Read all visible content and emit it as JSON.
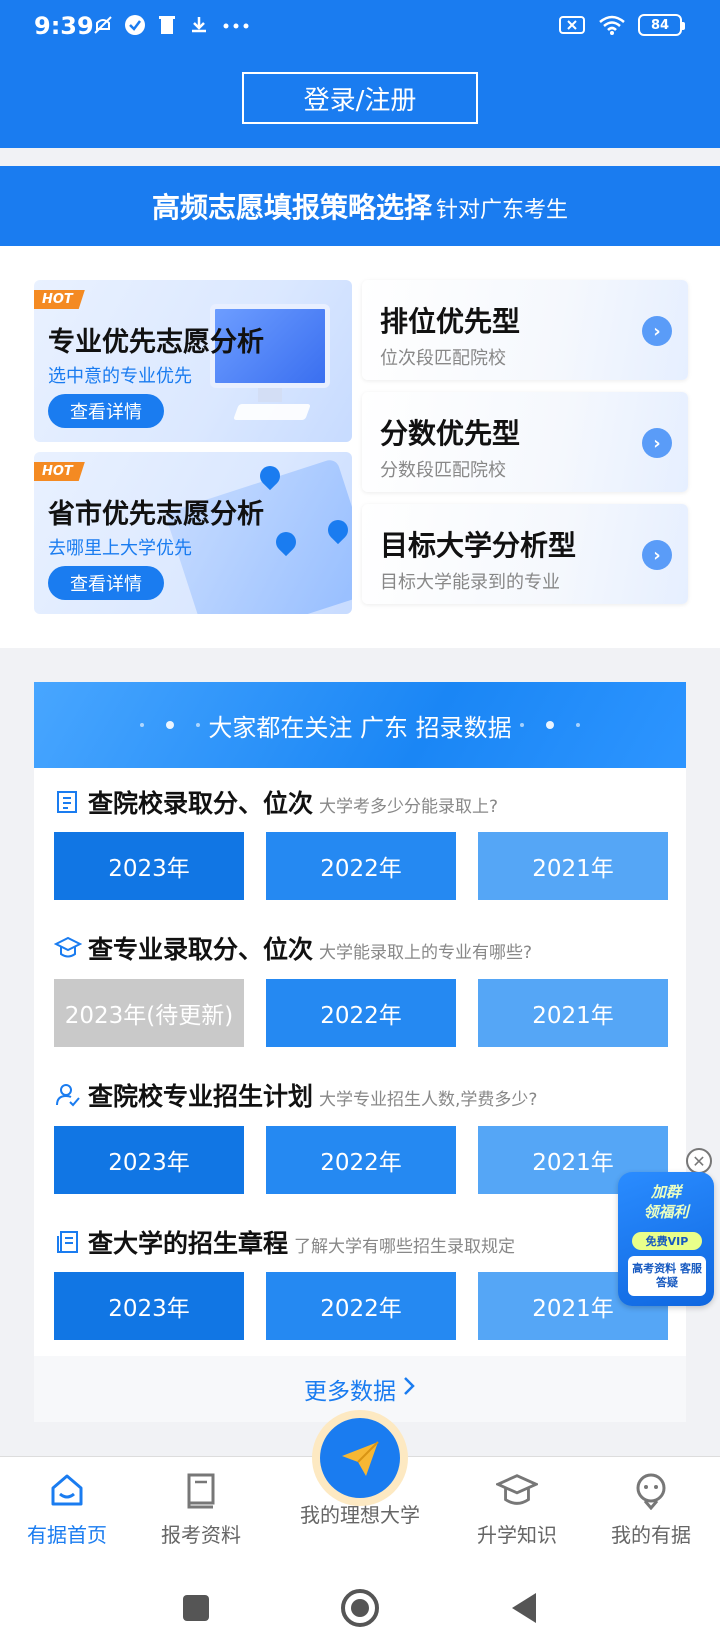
{
  "status_bar": {
    "time": "9:39",
    "battery": "84",
    "left_icons": [
      "mute-icon",
      "check-circle-icon",
      "trash-icon",
      "download-icon",
      "more-icon"
    ],
    "right_icons": [
      "sim-off-icon",
      "wifi-icon",
      "battery-icon"
    ]
  },
  "header": {
    "login_label": "登录/注册",
    "strategy_title": "高频志愿填报策略选择",
    "strategy_subtitle": "针对广东考生"
  },
  "cards": {
    "hot_label": "HOT",
    "detail_label": "查看详情",
    "major_priority": {
      "title": "专业优先志愿分析",
      "desc": "选中意的专业优先"
    },
    "city_priority": {
      "title": "省市优先志愿分析",
      "desc": "去哪里上大学优先"
    },
    "rank_priority": {
      "title": "排位优先型",
      "desc": "位次段匹配院校"
    },
    "score_priority": {
      "title": "分数优先型",
      "desc": "分数段匹配院校"
    },
    "target_university": {
      "title": "目标大学分析型",
      "desc": "目标大学能录到的专业"
    }
  },
  "data_panel": {
    "header": "大家都在关注 广东 招录数据",
    "rows": [
      {
        "title": "查院校录取分、位次",
        "subtitle": "大学考多少分能录取上?",
        "years": [
          "2023年",
          "2022年",
          "2021年"
        ]
      },
      {
        "title": "查专业录取分、位次",
        "subtitle": "大学能录取上的专业有哪些?",
        "years": [
          "2023年(待更新)",
          "2022年",
          "2021年"
        ]
      },
      {
        "title": "查院校专业招生计划",
        "subtitle": "大学专业招生人数,学费多少?",
        "years": [
          "2023年",
          "2022年",
          "2021年"
        ]
      },
      {
        "title": "查大学的招生章程",
        "subtitle": "了解大学有哪些招生录取规定",
        "years": [
          "2023年",
          "2022年",
          "2021年"
        ]
      }
    ],
    "more_label": "更多数据"
  },
  "promo": {
    "title_line1": "加群",
    "title_line2": "领福利",
    "vip": "免费VIP",
    "info": "高考资料 客服答疑"
  },
  "bottom_nav": {
    "items": [
      "有据首页",
      "报考资料",
      "我的理想大学",
      "升学知识",
      "我的有据"
    ],
    "active_index": 0
  },
  "colors": {
    "brand": "#1a7cf0",
    "hot": "#f48a22",
    "disabled": "#c9c9c9"
  }
}
